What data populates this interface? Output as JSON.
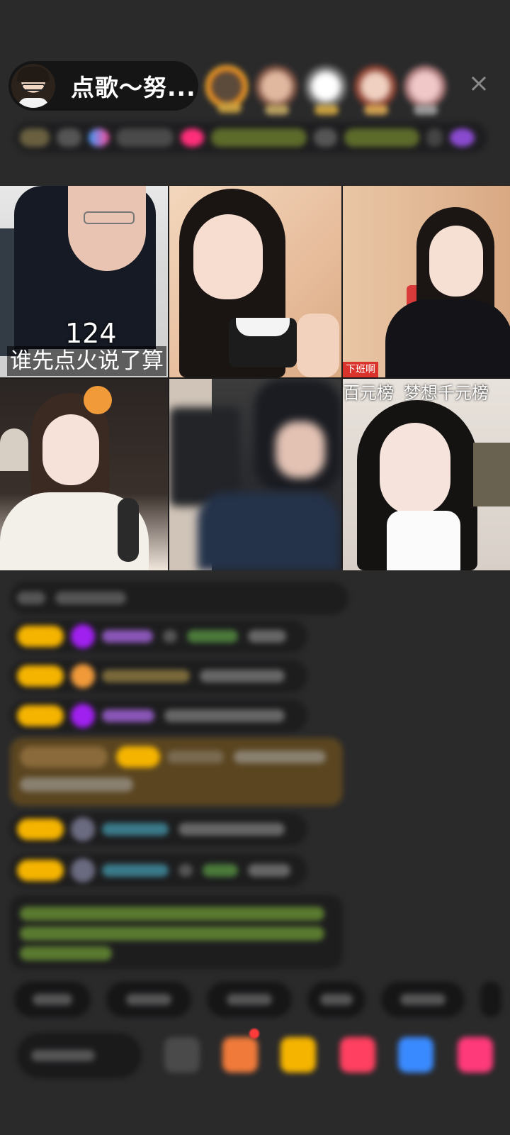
{
  "header": {
    "host_name": "点歌～努...",
    "close_glyph": "×"
  },
  "grid": {
    "score": "124",
    "banner": "谁先点火说了算",
    "tag": "下班啊",
    "rank_labels": [
      "百元榜",
      "梦想千元榜"
    ]
  },
  "colors": {
    "background": "#2a2a2b",
    "level_badge": "#f5b400",
    "gift_purple": "#a020f0",
    "gold_message": "#5a4520",
    "green_text": "#8bc34a",
    "live_red": "#d9332b"
  },
  "icons": [
    "host-avatar",
    "close-icon",
    "emoji-icon",
    "gift-icon",
    "more-icon"
  ]
}
